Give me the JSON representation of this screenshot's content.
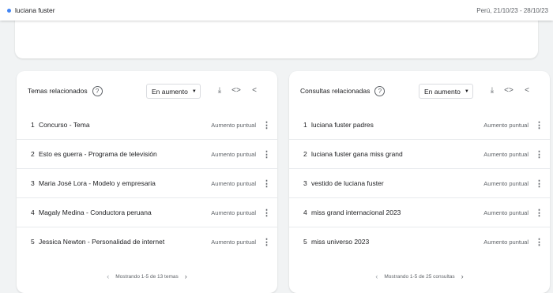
{
  "header": {
    "term": "luciana fuster",
    "meta": "Perú, 21/10/23 - 28/10/23"
  },
  "left_card": {
    "title": "Temas relacionados",
    "filter": "En aumento",
    "items": [
      {
        "rank": "1",
        "label": "Concurso - Tema",
        "value": "Aumento puntual"
      },
      {
        "rank": "2",
        "label": "Esto es guerra - Programa de televisión",
        "value": "Aumento puntual"
      },
      {
        "rank": "3",
        "label": "Maria José Lora - Modelo y empresaria",
        "value": "Aumento puntual"
      },
      {
        "rank": "4",
        "label": "Magaly Medina - Conductora peruana",
        "value": "Aumento puntual"
      },
      {
        "rank": "5",
        "label": "Jessica Newton - Personalidad de internet",
        "value": "Aumento puntual"
      }
    ],
    "pager": "Mostrando 1-5 de 13 temas"
  },
  "right_card": {
    "title": "Consultas relacionadas",
    "filter": "En aumento",
    "items": [
      {
        "rank": "1",
        "label": "luciana fuster padres",
        "value": "Aumento puntual"
      },
      {
        "rank": "2",
        "label": "luciana fuster gana miss grand",
        "value": "Aumento puntual"
      },
      {
        "rank": "3",
        "label": "vestido de luciana fuster",
        "value": "Aumento puntual"
      },
      {
        "rank": "4",
        "label": "miss grand internacional 2023",
        "value": "Aumento puntual"
      },
      {
        "rank": "5",
        "label": "miss universo 2023",
        "value": "Aumento puntual"
      }
    ],
    "pager": "Mostrando 1-5 de 25 consultas"
  },
  "icons": {
    "help": "help-circle-icon",
    "download": "download-icon",
    "embed": "embed-code-icon",
    "share": "share-icon",
    "more": "more-vert-icon",
    "prev": "chevron-left-icon",
    "next": "chevron-right-icon"
  },
  "colors": {
    "accent": "#4285f4",
    "background": "#f1f3f4",
    "card": "#ffffff",
    "muted_text": "#5f6368"
  }
}
